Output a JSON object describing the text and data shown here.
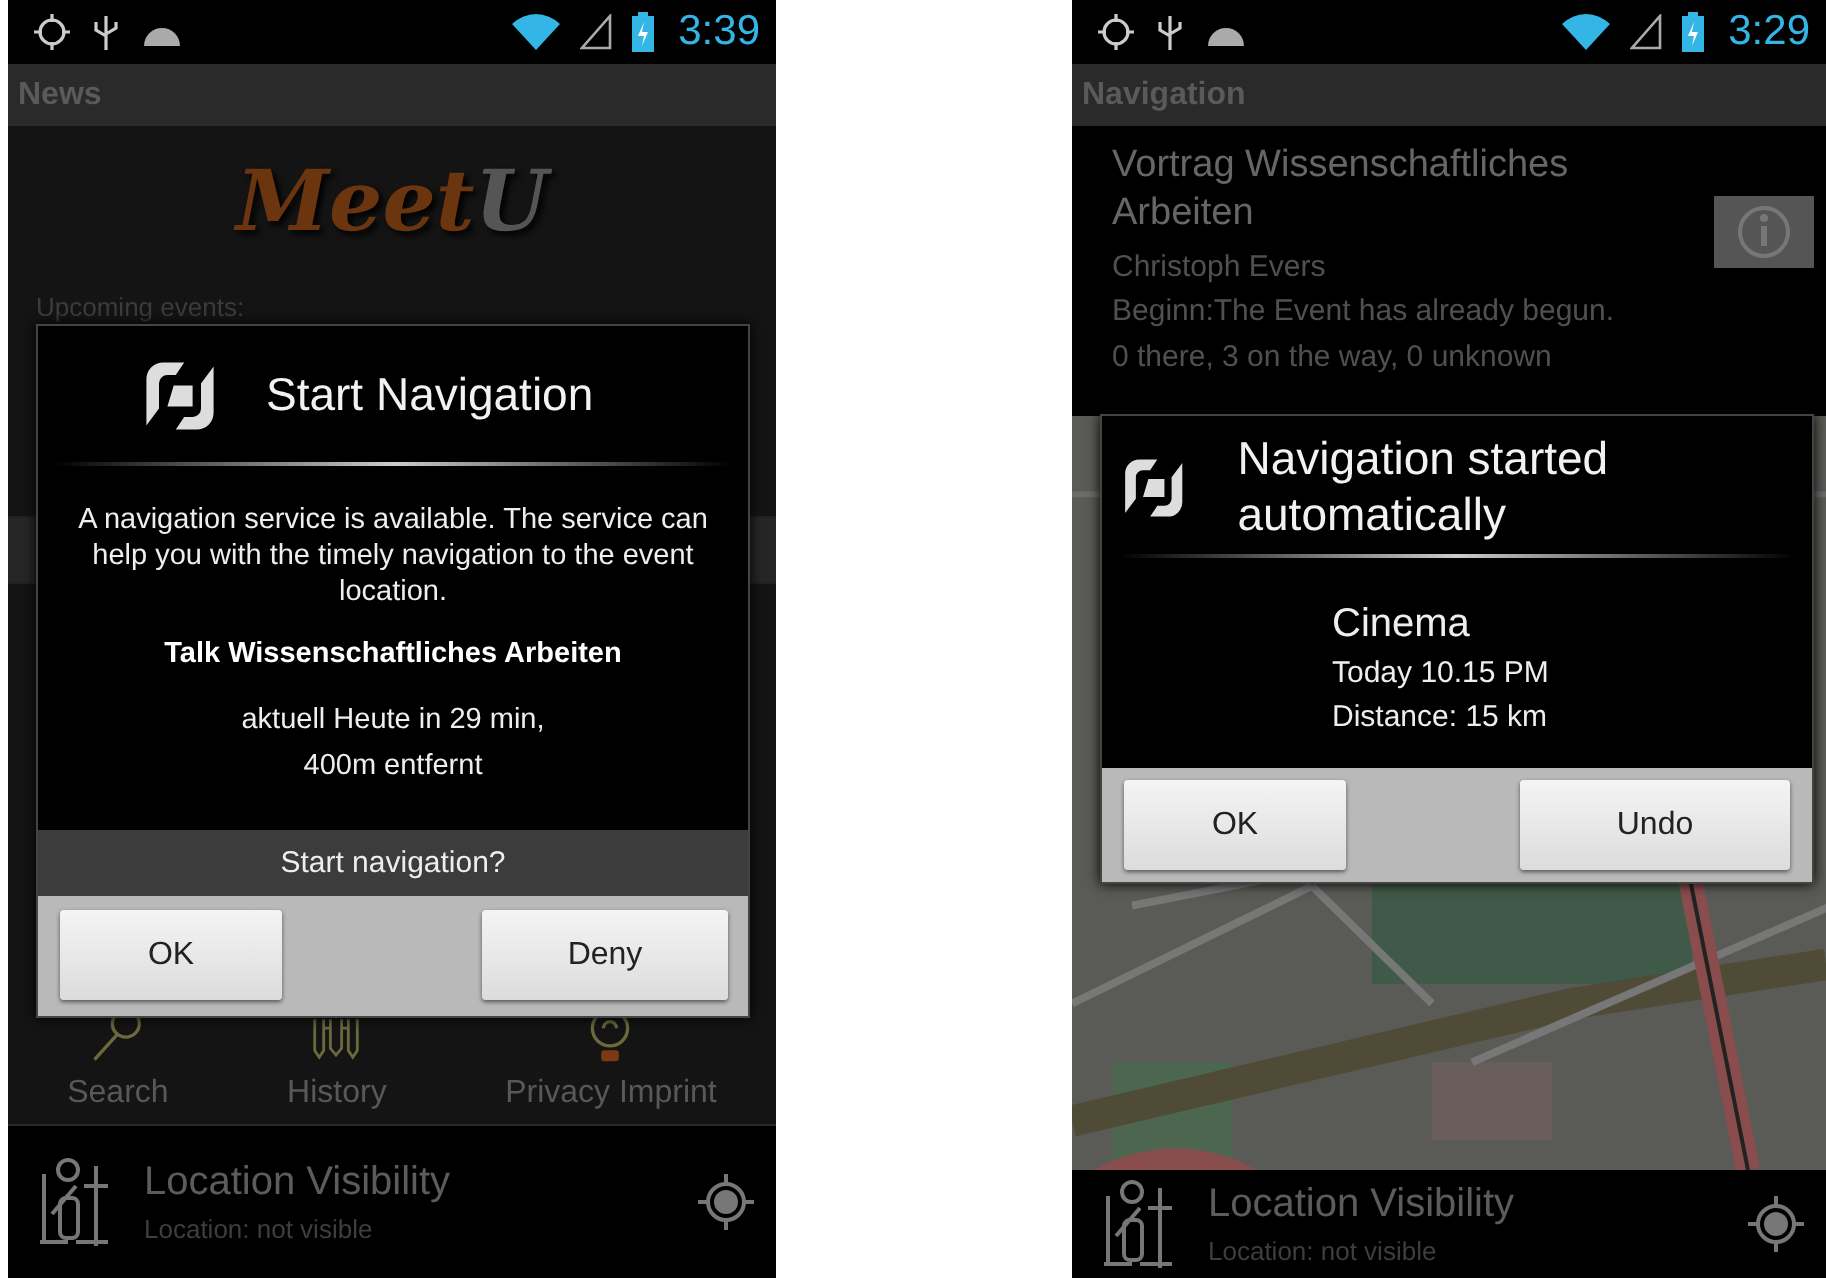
{
  "left_screen": {
    "status_bar": {
      "time": "3:39"
    },
    "title": "News",
    "logo": [
      "Meet",
      "U"
    ],
    "section_label": "Upcoming events:",
    "menu": [
      {
        "label": "Search"
      },
      {
        "label": "History"
      },
      {
        "label": "Privacy Imprint"
      }
    ],
    "dialog": {
      "title": "Start Navigation",
      "message": "A navigation service is available. The service can help you with the timely navigation to the event location.",
      "event": "Talk Wissenschaftliches Arbeiten",
      "details": [
        "aktuell Heute in 29 min,",
        "400m entfernt"
      ],
      "question": "Start navigation?",
      "buttons": [
        "OK",
        "Deny"
      ]
    },
    "location": {
      "title": "Location Visibility",
      "status": "Location: not visible"
    }
  },
  "right_screen": {
    "status_bar": {
      "time": "3:29"
    },
    "title": "Navigation",
    "event": {
      "title": "Vortrag Wissenschaftliches Arbeiten",
      "speaker": "Christoph Evers",
      "begin": "Beginn:The Event has already begun.",
      "attendance": "0 there, 3 on the way, 0 unknown"
    },
    "dialog": {
      "title": "Navigation started automatically",
      "place": "Cinema",
      "time": "Today 10.15 PM",
      "distance": "Distance: 15 km",
      "buttons": [
        "OK",
        "Undo"
      ]
    },
    "location": {
      "title": "Location Visibility",
      "status": "Location: not visible"
    }
  }
}
